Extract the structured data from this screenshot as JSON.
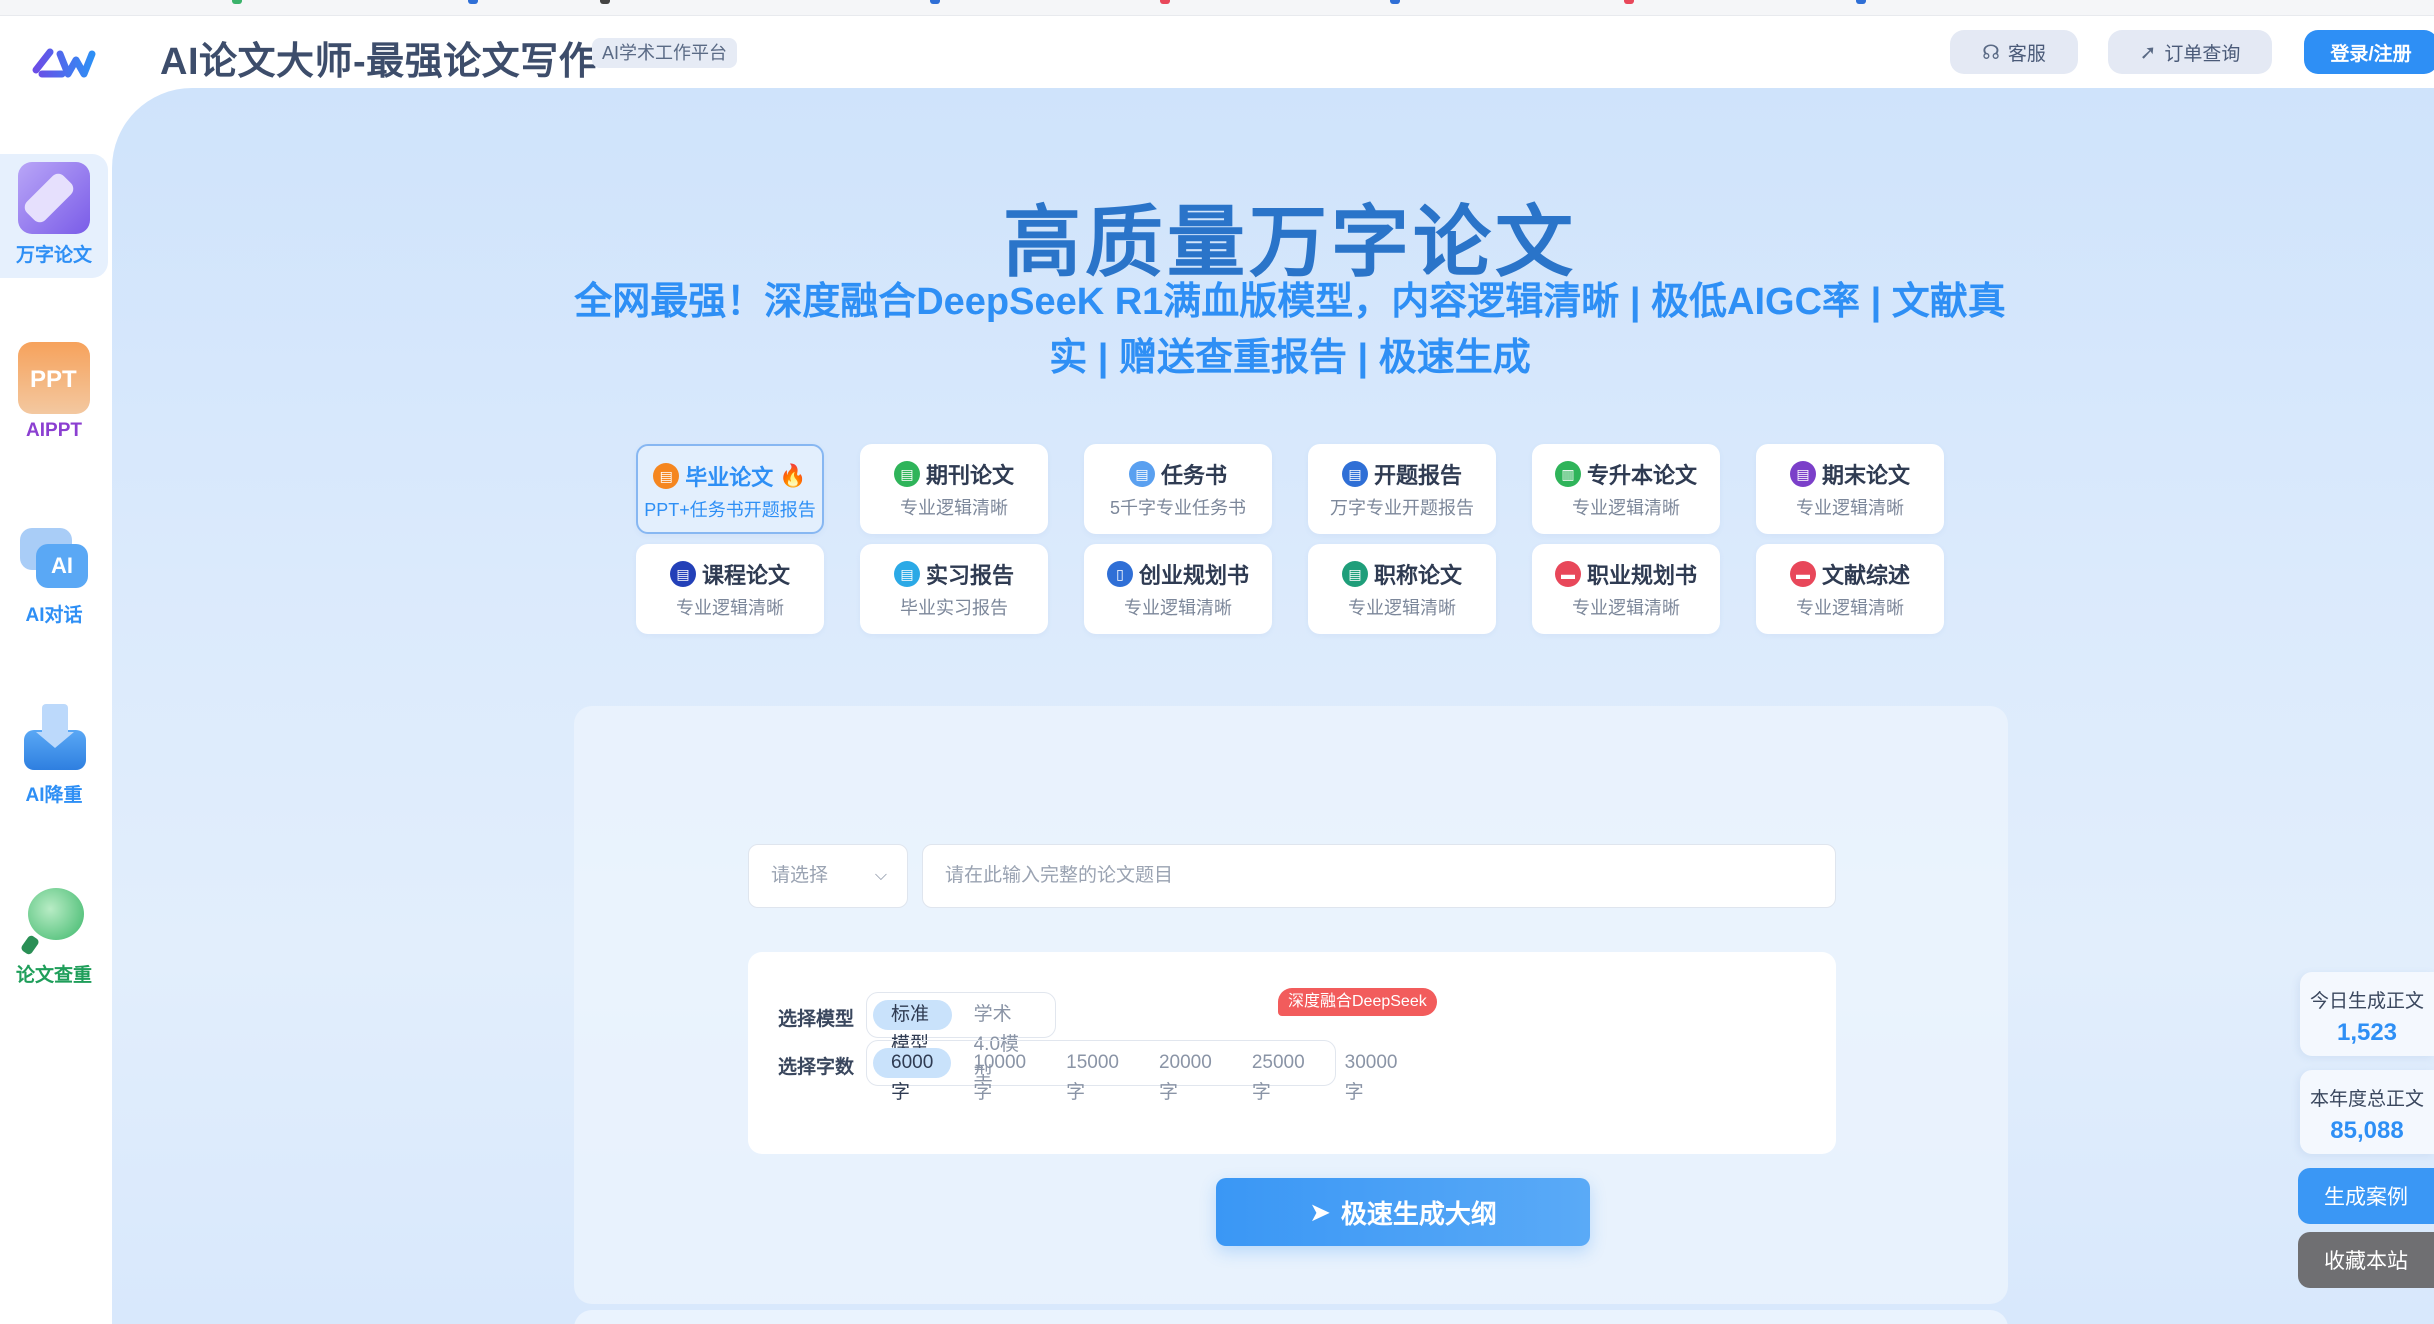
{
  "header": {
    "title": "AI论文大师-最强论文写作",
    "tag": "AI学术工作平台",
    "service_label": "客服",
    "order_label": "订单查询",
    "login_label": "登录/注册"
  },
  "sidebar": {
    "items": [
      {
        "label": "万字论文",
        "icon": "pen-icon",
        "color": "#2e8ff5"
      },
      {
        "label": "AIPPT",
        "icon": "ppt-icon",
        "color": "#8b3fd1"
      },
      {
        "label": "AI对话",
        "icon": "ai-chat-icon",
        "color": "#2e8ff5"
      },
      {
        "label": "AI降重",
        "icon": "download-tray-icon",
        "color": "#2e8ff5"
      },
      {
        "label": "论文查重",
        "icon": "magnifier-icon",
        "color": "#1f9e5a"
      }
    ]
  },
  "hero": {
    "title": "高质量万字论文",
    "subtitle": "全网最强！深度融合DeepSeeK R1满血版模型，内容逻辑清晰 | 极低AIGC率 | 文献真实 | 赠送查重报告 | 极速生成"
  },
  "cards": [
    {
      "title": "毕业论文",
      "sub": "PPT+任务书开题报告",
      "color": "#f5861f",
      "active": true
    },
    {
      "title": "期刊论文",
      "sub": "专业逻辑清晰",
      "color": "#2fb45a"
    },
    {
      "title": "任务书",
      "sub": "5千字专业任务书",
      "color": "#5aa0f0"
    },
    {
      "title": "开题报告",
      "sub": "万字专业开题报告",
      "color": "#2f6fd6"
    },
    {
      "title": "专升本论文",
      "sub": "专业逻辑清晰",
      "color": "#2fb45a"
    },
    {
      "title": "期末论文",
      "sub": "专业逻辑清晰",
      "color": "#7b3fc9"
    },
    {
      "title": "课程论文",
      "sub": "专业逻辑清晰",
      "color": "#2340b8"
    },
    {
      "title": "实习报告",
      "sub": "毕业实习报告",
      "color": "#2ba9e6"
    },
    {
      "title": "创业规划书",
      "sub": "专业逻辑清晰",
      "color": "#2f6fd6"
    },
    {
      "title": "职称论文",
      "sub": "专业逻辑清晰",
      "color": "#1f9e7a"
    },
    {
      "title": "职业规划书",
      "sub": "专业逻辑清晰",
      "color": "#e8475a"
    },
    {
      "title": "文献综述",
      "sub": "专业逻辑清晰",
      "color": "#e8475a"
    }
  ],
  "form": {
    "select_placeholder": "请选择",
    "topic_placeholder": "请在此输入完整的论文题目",
    "model_label": "选择模型",
    "models": [
      "标准模型",
      "学术4.0模型"
    ],
    "model_badge": "深度融合DeepSeek",
    "words_label": "选择字数",
    "word_options": [
      "6000字",
      "10000字",
      "15000字",
      "20000字",
      "25000字",
      "30000字"
    ],
    "submit_label": "极速生成大纲"
  },
  "stats": {
    "today_label": "今日生成正文",
    "today_value": "1,523",
    "year_label": "本年度总正文",
    "year_value": "85,088",
    "cases_label": "生成案例",
    "bookmark_label": "收藏本站"
  }
}
